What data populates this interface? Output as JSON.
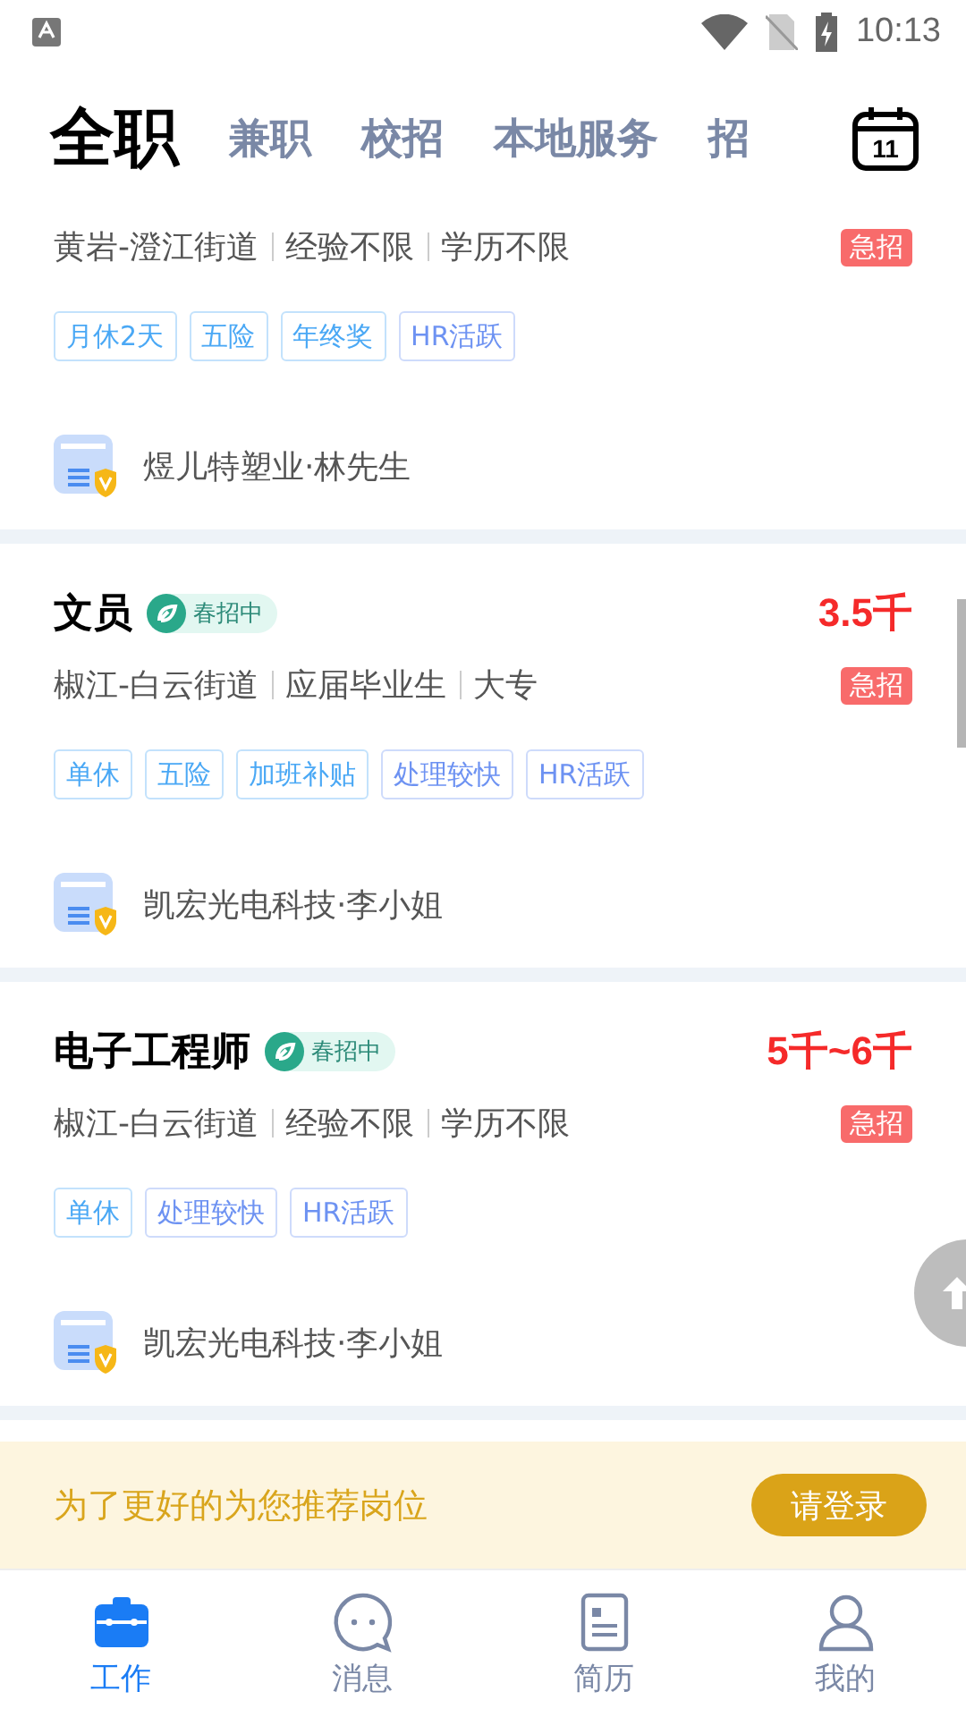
{
  "status_bar": {
    "time": "10:13"
  },
  "tabs": [
    {
      "label": "全职",
      "selected": true
    },
    {
      "label": "兼职",
      "selected": false
    },
    {
      "label": "校招",
      "selected": false
    },
    {
      "label": "本地服务",
      "selected": false
    },
    {
      "label": "招",
      "selected": false
    }
  ],
  "calendar_day": "11",
  "jobs": [
    {
      "meta": [
        "黄岩-澄江街道",
        "经验不限",
        "学历不限"
      ],
      "urgent": "急招",
      "tags": [
        {
          "label": "月休2天",
          "color": "#4aa8f5"
        },
        {
          "label": "五险",
          "color": "#4aa8f5"
        },
        {
          "label": "年终奖",
          "color": "#4aa8f5"
        },
        {
          "label": "HR活跃",
          "color": "#6d92f2"
        }
      ],
      "company": "煜儿特塑业·林先生"
    },
    {
      "title": "文员",
      "badge": "春招中",
      "salary": "3.5千",
      "meta": [
        "椒江-白云街道",
        "应届毕业生",
        "大专"
      ],
      "urgent": "急招",
      "tags": [
        {
          "label": "单休",
          "color": "#4aa8f5"
        },
        {
          "label": "五险",
          "color": "#4aa8f5"
        },
        {
          "label": "加班补贴",
          "color": "#4aa8f5"
        },
        {
          "label": "处理较快",
          "color": "#6d92f2"
        },
        {
          "label": "HR活跃",
          "color": "#6d92f2"
        }
      ],
      "company": "凯宏光电科技·李小姐"
    },
    {
      "title": "电子工程师",
      "badge": "春招中",
      "salary": "5千~6千",
      "meta": [
        "椒江-白云街道",
        "经验不限",
        "学历不限"
      ],
      "urgent": "急招",
      "tags": [
        {
          "label": "单休",
          "color": "#4aa8f5"
        },
        {
          "label": "处理较快",
          "color": "#6d92f2"
        },
        {
          "label": "HR活跃",
          "color": "#6d92f2"
        }
      ],
      "company": "凯宏光电科技·李小姐"
    }
  ],
  "login_banner": {
    "text": "为了更好的为您推荐岗位",
    "button": "请登录"
  },
  "nav": [
    {
      "label": "工作",
      "selected": true
    },
    {
      "label": "消息",
      "selected": false
    },
    {
      "label": "简历",
      "selected": false
    },
    {
      "label": "我的",
      "selected": false
    }
  ]
}
